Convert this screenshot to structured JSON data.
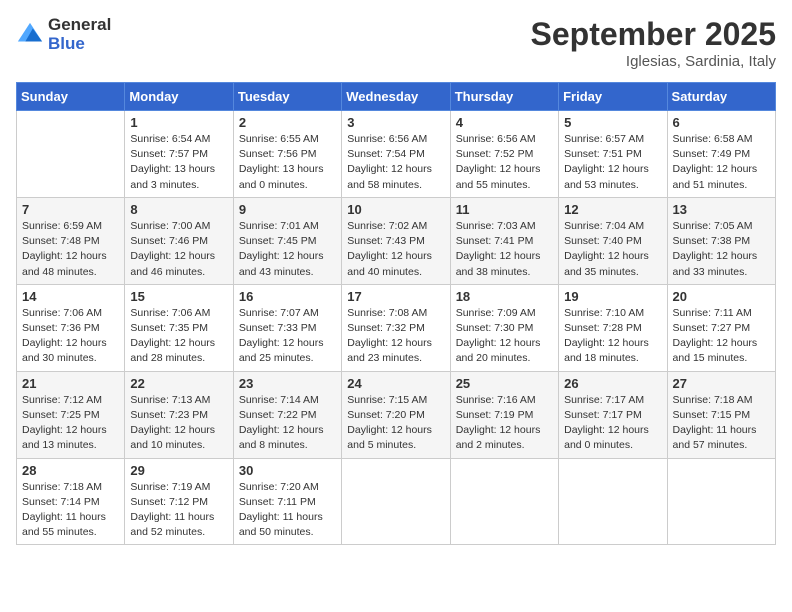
{
  "logo": {
    "general": "General",
    "blue": "Blue"
  },
  "title": "September 2025",
  "location": "Iglesias, Sardinia, Italy",
  "weekdays": [
    "Sunday",
    "Monday",
    "Tuesday",
    "Wednesday",
    "Thursday",
    "Friday",
    "Saturday"
  ],
  "weeks": [
    [
      {
        "day": "",
        "info": ""
      },
      {
        "day": "1",
        "info": "Sunrise: 6:54 AM\nSunset: 7:57 PM\nDaylight: 13 hours\nand 3 minutes."
      },
      {
        "day": "2",
        "info": "Sunrise: 6:55 AM\nSunset: 7:56 PM\nDaylight: 13 hours\nand 0 minutes."
      },
      {
        "day": "3",
        "info": "Sunrise: 6:56 AM\nSunset: 7:54 PM\nDaylight: 12 hours\nand 58 minutes."
      },
      {
        "day": "4",
        "info": "Sunrise: 6:56 AM\nSunset: 7:52 PM\nDaylight: 12 hours\nand 55 minutes."
      },
      {
        "day": "5",
        "info": "Sunrise: 6:57 AM\nSunset: 7:51 PM\nDaylight: 12 hours\nand 53 minutes."
      },
      {
        "day": "6",
        "info": "Sunrise: 6:58 AM\nSunset: 7:49 PM\nDaylight: 12 hours\nand 51 minutes."
      }
    ],
    [
      {
        "day": "7",
        "info": "Sunrise: 6:59 AM\nSunset: 7:48 PM\nDaylight: 12 hours\nand 48 minutes."
      },
      {
        "day": "8",
        "info": "Sunrise: 7:00 AM\nSunset: 7:46 PM\nDaylight: 12 hours\nand 46 minutes."
      },
      {
        "day": "9",
        "info": "Sunrise: 7:01 AM\nSunset: 7:45 PM\nDaylight: 12 hours\nand 43 minutes."
      },
      {
        "day": "10",
        "info": "Sunrise: 7:02 AM\nSunset: 7:43 PM\nDaylight: 12 hours\nand 40 minutes."
      },
      {
        "day": "11",
        "info": "Sunrise: 7:03 AM\nSunset: 7:41 PM\nDaylight: 12 hours\nand 38 minutes."
      },
      {
        "day": "12",
        "info": "Sunrise: 7:04 AM\nSunset: 7:40 PM\nDaylight: 12 hours\nand 35 minutes."
      },
      {
        "day": "13",
        "info": "Sunrise: 7:05 AM\nSunset: 7:38 PM\nDaylight: 12 hours\nand 33 minutes."
      }
    ],
    [
      {
        "day": "14",
        "info": "Sunrise: 7:06 AM\nSunset: 7:36 PM\nDaylight: 12 hours\nand 30 minutes."
      },
      {
        "day": "15",
        "info": "Sunrise: 7:06 AM\nSunset: 7:35 PM\nDaylight: 12 hours\nand 28 minutes."
      },
      {
        "day": "16",
        "info": "Sunrise: 7:07 AM\nSunset: 7:33 PM\nDaylight: 12 hours\nand 25 minutes."
      },
      {
        "day": "17",
        "info": "Sunrise: 7:08 AM\nSunset: 7:32 PM\nDaylight: 12 hours\nand 23 minutes."
      },
      {
        "day": "18",
        "info": "Sunrise: 7:09 AM\nSunset: 7:30 PM\nDaylight: 12 hours\nand 20 minutes."
      },
      {
        "day": "19",
        "info": "Sunrise: 7:10 AM\nSunset: 7:28 PM\nDaylight: 12 hours\nand 18 minutes."
      },
      {
        "day": "20",
        "info": "Sunrise: 7:11 AM\nSunset: 7:27 PM\nDaylight: 12 hours\nand 15 minutes."
      }
    ],
    [
      {
        "day": "21",
        "info": "Sunrise: 7:12 AM\nSunset: 7:25 PM\nDaylight: 12 hours\nand 13 minutes."
      },
      {
        "day": "22",
        "info": "Sunrise: 7:13 AM\nSunset: 7:23 PM\nDaylight: 12 hours\nand 10 minutes."
      },
      {
        "day": "23",
        "info": "Sunrise: 7:14 AM\nSunset: 7:22 PM\nDaylight: 12 hours\nand 8 minutes."
      },
      {
        "day": "24",
        "info": "Sunrise: 7:15 AM\nSunset: 7:20 PM\nDaylight: 12 hours\nand 5 minutes."
      },
      {
        "day": "25",
        "info": "Sunrise: 7:16 AM\nSunset: 7:19 PM\nDaylight: 12 hours\nand 2 minutes."
      },
      {
        "day": "26",
        "info": "Sunrise: 7:17 AM\nSunset: 7:17 PM\nDaylight: 12 hours\nand 0 minutes."
      },
      {
        "day": "27",
        "info": "Sunrise: 7:18 AM\nSunset: 7:15 PM\nDaylight: 11 hours\nand 57 minutes."
      }
    ],
    [
      {
        "day": "28",
        "info": "Sunrise: 7:18 AM\nSunset: 7:14 PM\nDaylight: 11 hours\nand 55 minutes."
      },
      {
        "day": "29",
        "info": "Sunrise: 7:19 AM\nSunset: 7:12 PM\nDaylight: 11 hours\nand 52 minutes."
      },
      {
        "day": "30",
        "info": "Sunrise: 7:20 AM\nSunset: 7:11 PM\nDaylight: 11 hours\nand 50 minutes."
      },
      {
        "day": "",
        "info": ""
      },
      {
        "day": "",
        "info": ""
      },
      {
        "day": "",
        "info": ""
      },
      {
        "day": "",
        "info": ""
      }
    ]
  ]
}
